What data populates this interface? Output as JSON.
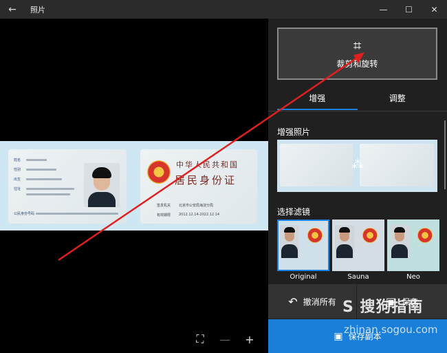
{
  "window": {
    "back_glyph": "←",
    "title": "照片",
    "minimize_glyph": "—",
    "maximize_glyph": "☐",
    "close_glyph": "✕"
  },
  "canvas": {
    "id_front": {
      "labels": [
        "姓名",
        "性别",
        "出生",
        "住址",
        "公民身份号码"
      ]
    },
    "id_back": {
      "line1": "中华人民共和国",
      "line2": "居民身份证",
      "authority_label": "签发机关",
      "authority_value": "北京市公安局海淀分局",
      "validity_label": "有效期限",
      "validity_value": "2012.12.14-2022.12.14"
    },
    "tools": {
      "fit_glyph": "⛶",
      "zoom_out_glyph": "—",
      "zoom_in_glyph": "+"
    }
  },
  "panel": {
    "crop_button": {
      "icon": "crop-icon",
      "glyph": "⌗",
      "label": "裁剪和旋转"
    },
    "tabs": [
      {
        "label": "增强",
        "active": true
      },
      {
        "label": "调整",
        "active": false
      }
    ],
    "enhance_label": "增强照片",
    "enhance_wand_glyph": "⁂",
    "filters_label": "选择滤镜",
    "filters": [
      {
        "name": "Original",
        "selected": true
      },
      {
        "name": "Sauna",
        "selected": false
      },
      {
        "name": "Neo",
        "selected": false
      }
    ],
    "undo_all": {
      "glyph": "↶",
      "label": "撤消所有"
    },
    "save": {
      "glyph": "▣",
      "label": "保存"
    },
    "save_copy": {
      "glyph": "▣",
      "label": "保存副本"
    }
  },
  "watermark": {
    "text": "S 搜狗指南",
    "url": "zhinan.sogou.com"
  },
  "colors": {
    "accent": "#1a82e2",
    "panel_bg": "#202020",
    "titlebar_bg": "#2b2b2b",
    "annotation": "#e02020"
  }
}
